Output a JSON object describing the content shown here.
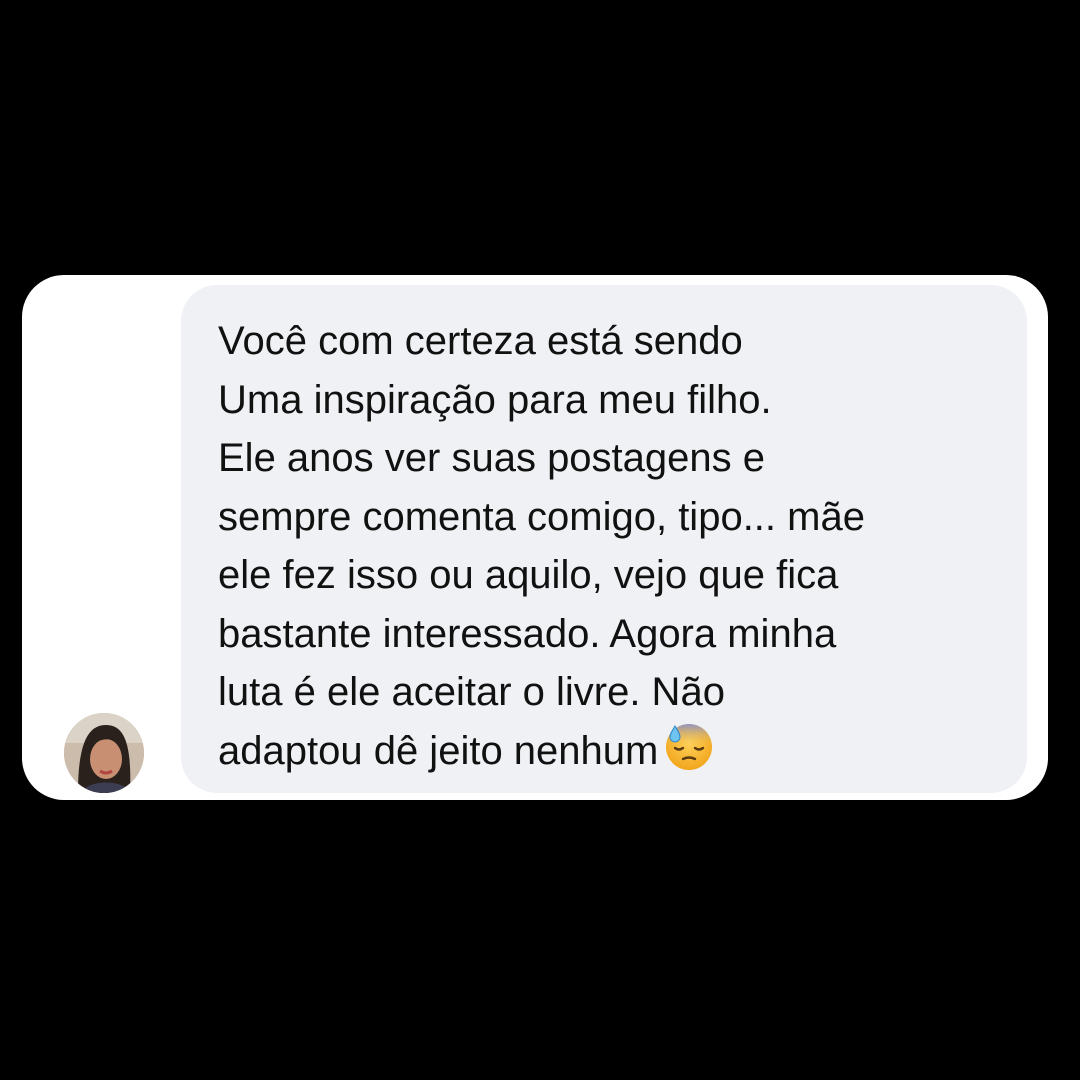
{
  "message": {
    "lines": [
      "Você com certeza está sendo",
      "Uma inspiração para meu filho.",
      "Ele anos ver suas postagens e",
      "sempre comenta comigo, tipo... mãe",
      "ele fez isso ou aquilo, vejo que fica",
      "bastante interessado. Agora minha",
      "luta é ele aceitar o livre. Não",
      "adaptou dê jeito nenhum"
    ],
    "emoji": "downcast-face-with-sweat-icon"
  },
  "sender": {
    "avatar": "user-avatar"
  },
  "colors": {
    "background": "#000000",
    "card": "#ffffff",
    "bubble": "#eff1f4",
    "text": "#111111"
  }
}
